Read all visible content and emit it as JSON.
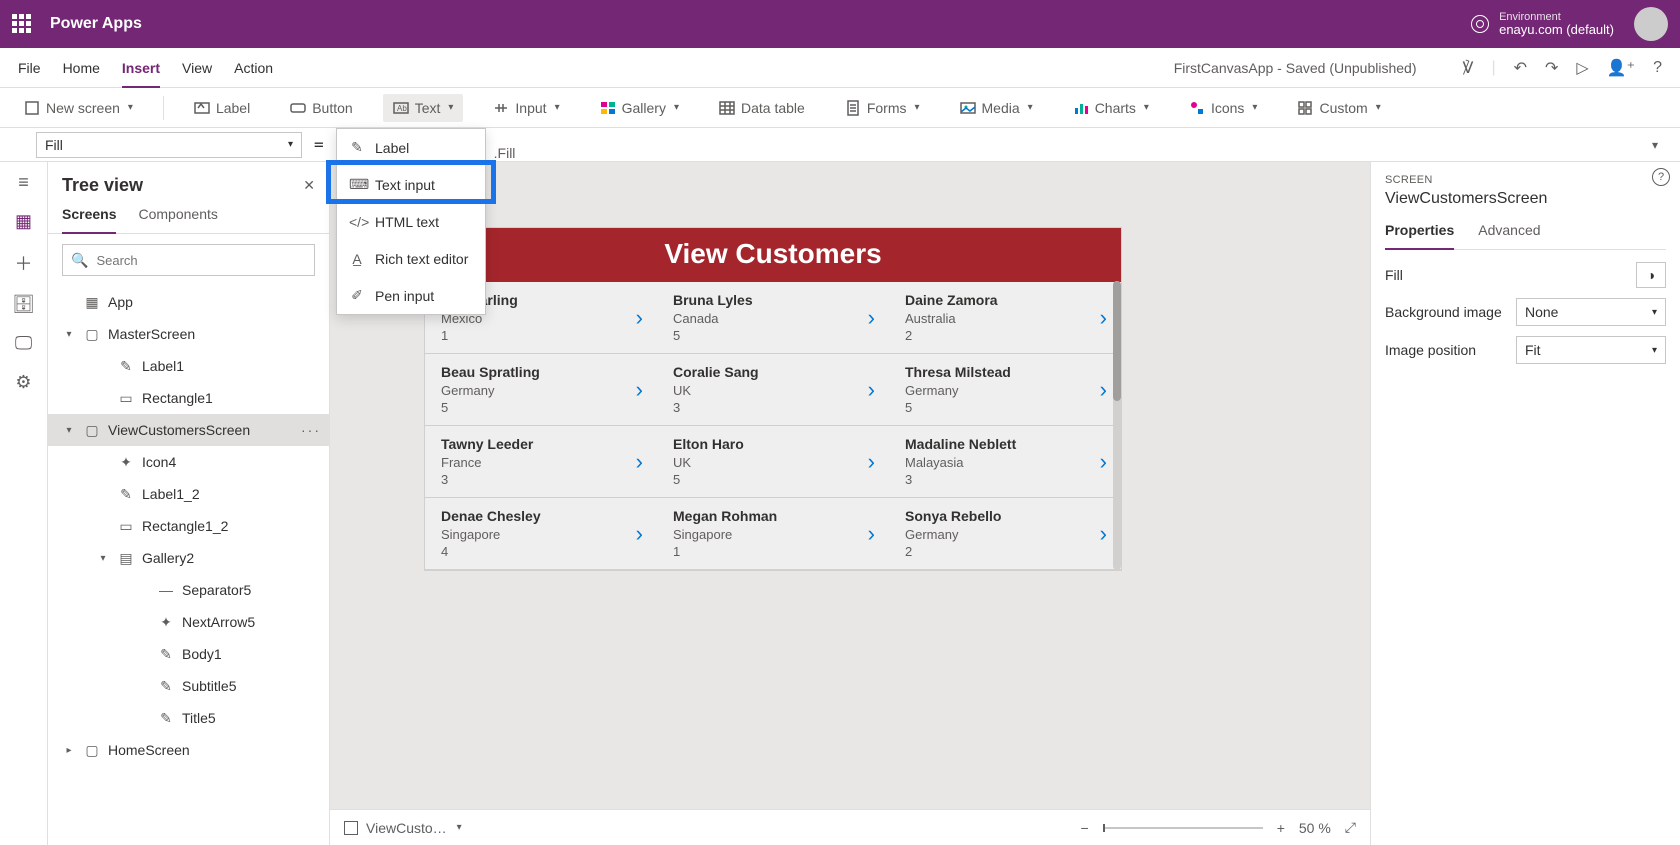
{
  "header": {
    "brand": "Power Apps",
    "env_label": "Environment",
    "env_name": "enayu.com (default)"
  },
  "menubar": {
    "items": [
      "File",
      "Home",
      "Insert",
      "View",
      "Action"
    ],
    "active": "Insert",
    "title": "FirstCanvasApp - Saved (Unpublished)"
  },
  "ribbon": {
    "newscreen": "New screen",
    "label": "Label",
    "button": "Button",
    "text": "Text",
    "input": "Input",
    "gallery": "Gallery",
    "datatable": "Data table",
    "forms": "Forms",
    "media": "Media",
    "charts": "Charts",
    "icons": "Icons",
    "custom": "Custom"
  },
  "text_menu": [
    "Label",
    "Text input",
    "HTML text",
    "Rich text editor",
    "Pen input"
  ],
  "formula": {
    "prop": "Fill",
    "visible_expr": ".Fill"
  },
  "tree": {
    "title": "Tree view",
    "tabs": [
      "Screens",
      "Components"
    ],
    "active_tab": "Screens",
    "search_ph": "Search",
    "nodes": [
      {
        "pad": 0,
        "tw": "",
        "ic": "app",
        "label": "App"
      },
      {
        "pad": 0,
        "tw": "▾",
        "ic": "screen",
        "label": "MasterScreen"
      },
      {
        "pad": 2,
        "tw": "",
        "ic": "label",
        "label": "Label1"
      },
      {
        "pad": 2,
        "tw": "",
        "ic": "rect",
        "label": "Rectangle1"
      },
      {
        "pad": 0,
        "tw": "▾",
        "ic": "screen",
        "label": "ViewCustomersScreen",
        "sel": true,
        "more": true
      },
      {
        "pad": 2,
        "tw": "",
        "ic": "icon",
        "label": "Icon4"
      },
      {
        "pad": 2,
        "tw": "",
        "ic": "label",
        "label": "Label1_2"
      },
      {
        "pad": 2,
        "tw": "",
        "ic": "rect",
        "label": "Rectangle1_2"
      },
      {
        "pad": 2,
        "tw": "▾",
        "ic": "gallery",
        "label": "Gallery2"
      },
      {
        "pad": 4,
        "tw": "",
        "ic": "sep",
        "label": "Separator5"
      },
      {
        "pad": 4,
        "tw": "",
        "ic": "icon",
        "label": "NextArrow5"
      },
      {
        "pad": 4,
        "tw": "",
        "ic": "label",
        "label": "Body1"
      },
      {
        "pad": 4,
        "tw": "",
        "ic": "label",
        "label": "Subtitle5"
      },
      {
        "pad": 4,
        "tw": "",
        "ic": "label",
        "label": "Title5"
      },
      {
        "pad": 0,
        "tw": "▸",
        "ic": "screen",
        "label": "HomeScreen"
      }
    ]
  },
  "stage": {
    "title": "View Customers",
    "rows": [
      [
        {
          "n": "Viki  Darling",
          "c": "Mexico",
          "id": "1"
        },
        {
          "n": "Bruna  Lyles",
          "c": "Canada",
          "id": "5"
        },
        {
          "n": "Daine  Zamora",
          "c": "Australia",
          "id": "2"
        }
      ],
      [
        {
          "n": "Beau  Spratling",
          "c": "Germany",
          "id": "5"
        },
        {
          "n": "Coralie  Sang",
          "c": "UK",
          "id": "3"
        },
        {
          "n": "Thresa  Milstead",
          "c": "Germany",
          "id": "5"
        }
      ],
      [
        {
          "n": "Tawny  Leeder",
          "c": "France",
          "id": "3"
        },
        {
          "n": "Elton  Haro",
          "c": "UK",
          "id": "5"
        },
        {
          "n": "Madaline  Neblett",
          "c": "Malayasia",
          "id": "3"
        }
      ],
      [
        {
          "n": "Denae  Chesley",
          "c": "Singapore",
          "id": "4"
        },
        {
          "n": "Megan  Rohman",
          "c": "Singapore",
          "id": "1"
        },
        {
          "n": "Sonya  Rebello",
          "c": "Germany",
          "id": "2"
        }
      ]
    ]
  },
  "cfoot": {
    "crumb": "ViewCusto…",
    "zoom": "50  %"
  },
  "props": {
    "section": "SCREEN",
    "name": "ViewCustomersScreen",
    "tabs": [
      "Properties",
      "Advanced"
    ],
    "active": "Properties",
    "fill_label": "Fill",
    "bgimg_label": "Background image",
    "bgimg_value": "None",
    "imgpos_label": "Image position",
    "imgpos_value": "Fit"
  }
}
